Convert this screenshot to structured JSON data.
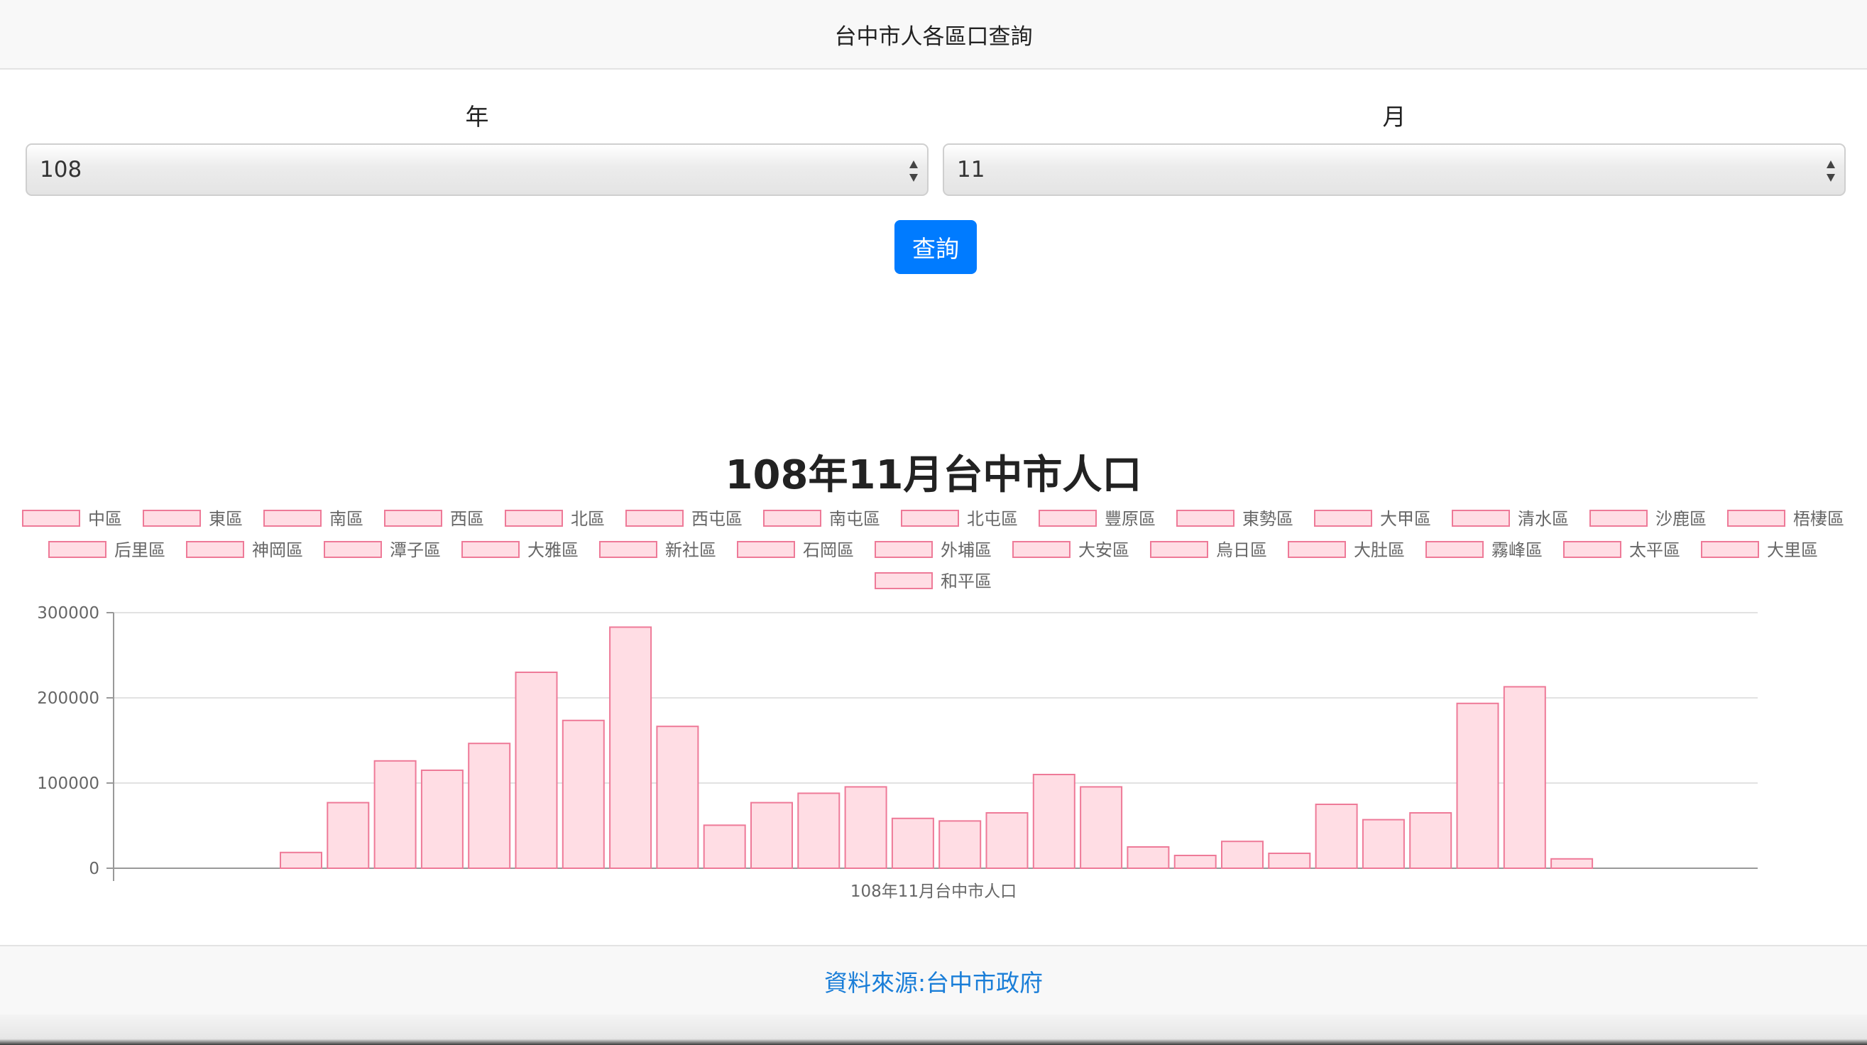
{
  "header": {
    "title": "台中市人各區口查詢"
  },
  "form": {
    "year_label": "年",
    "year_value": "108",
    "month_label": "月",
    "month_value": "11",
    "submit_label": "查詢"
  },
  "chart_title": "108年11月台中市人口",
  "chart_data": {
    "type": "bar",
    "title": "108年11月台中市人口",
    "xlabel": "108年11月台中市人口",
    "ylabel": "",
    "ylim": [
      0,
      300000
    ],
    "yticks": [
      0,
      100000,
      200000,
      300000
    ],
    "legend_position": "top",
    "categories": [
      "中區",
      "東區",
      "南區",
      "西區",
      "北區",
      "西屯區",
      "南屯區",
      "北屯區",
      "豐原區",
      "東勢區",
      "大甲區",
      "清水區",
      "沙鹿區",
      "梧棲區",
      "后里區",
      "神岡區",
      "潭子區",
      "大雅區",
      "新社區",
      "石岡區",
      "外埔區",
      "大安區",
      "烏日區",
      "大肚區",
      "霧峰區",
      "太平區",
      "大里區",
      "和平區"
    ],
    "values": [
      18500,
      77000,
      126000,
      115000,
      146500,
      230000,
      173500,
      283000,
      166500,
      50500,
      77000,
      88000,
      95500,
      58500,
      55500,
      65000,
      110000,
      95500,
      25000,
      15000,
      31500,
      17500,
      75000,
      57000,
      65000,
      193500,
      213000,
      11000
    ],
    "fill_color": "#ffdde4",
    "border_color": "#ee7a98"
  },
  "footer": {
    "source_text": "資料來源:台中市政府"
  }
}
